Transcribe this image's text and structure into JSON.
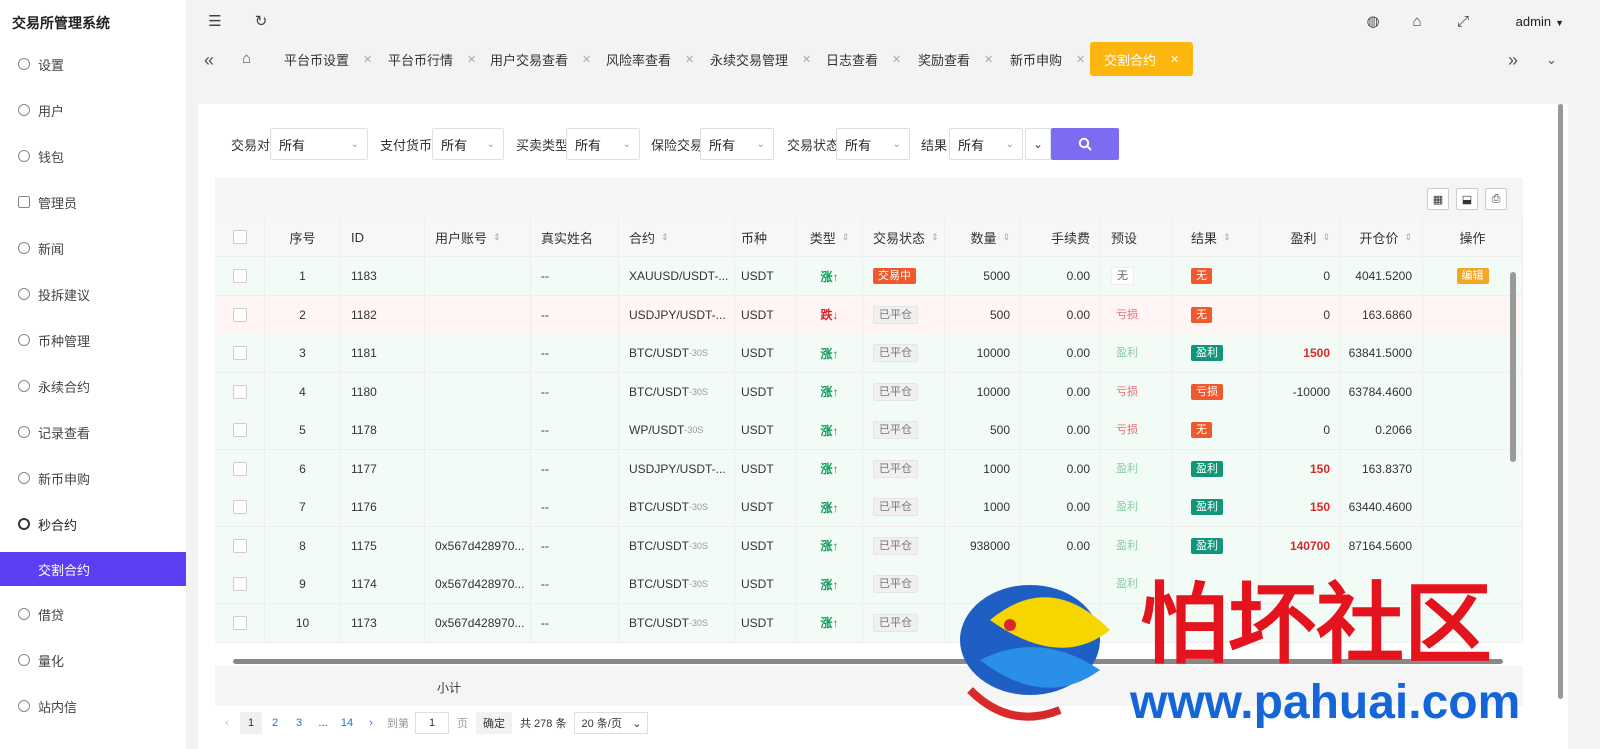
{
  "app": {
    "title": "交易所管理系统",
    "user": "admin"
  },
  "sidebar": {
    "items": [
      {
        "label": "设置"
      },
      {
        "label": "用户"
      },
      {
        "label": "钱包"
      },
      {
        "label": "管理员"
      },
      {
        "label": "新闻"
      },
      {
        "label": "投拆建议"
      },
      {
        "label": "币种管理"
      },
      {
        "label": "永续合约"
      },
      {
        "label": "记录查看"
      },
      {
        "label": "新币申购"
      },
      {
        "label": "秒合约"
      },
      {
        "label": "交割合约"
      },
      {
        "label": "借贷"
      },
      {
        "label": "量化"
      },
      {
        "label": "站内信"
      }
    ]
  },
  "tabs": [
    {
      "label": "平台币设置"
    },
    {
      "label": "平台币行情"
    },
    {
      "label": "用户交易查看"
    },
    {
      "label": "风险率查看"
    },
    {
      "label": "永续交易管理"
    },
    {
      "label": "日志查看"
    },
    {
      "label": "奖励查看"
    },
    {
      "label": "新币申购"
    },
    {
      "label": "交割合约"
    }
  ],
  "filters": [
    {
      "label": "交易对",
      "value": "所有"
    },
    {
      "label": "支付货币",
      "value": "所有"
    },
    {
      "label": "买卖类型",
      "value": "所有"
    },
    {
      "label": "保险交易",
      "value": "所有"
    },
    {
      "label": "交易状态",
      "value": "所有"
    },
    {
      "label": "结果",
      "value": "所有"
    }
  ],
  "table": {
    "headers": [
      "序号",
      "ID",
      "用户账号",
      "真实姓名",
      "合约",
      "币种",
      "类型",
      "交易状态",
      "数量",
      "手续费",
      "预设",
      "结果",
      "盈利",
      "开仓价",
      "操作"
    ],
    "rows": [
      {
        "no": "1",
        "id": "1183",
        "account": "",
        "name": "--",
        "contract": "XAUUSD/USDT-...",
        "suffix": "",
        "coin": "USDT",
        "type": "涨↑",
        "dir": "up",
        "status": "交易中",
        "status_kind": "red",
        "qty": "5000",
        "fee": "0.00",
        "preset": "无",
        "preset_kind": "plain",
        "result": "无",
        "result_kind": "red",
        "profit": "0",
        "profit_kind": "",
        "open": "4041.5200",
        "action": "编辑"
      },
      {
        "no": "2",
        "id": "1182",
        "account": "",
        "name": "--",
        "contract": "USDJPY/USDT-...",
        "suffix": "",
        "coin": "USDT",
        "type": "跌↓",
        "dir": "down",
        "status": "已平仓",
        "status_kind": "grey",
        "qty": "500",
        "fee": "0.00",
        "preset": "亏损",
        "preset_kind": "loss",
        "result": "无",
        "result_kind": "red",
        "profit": "0",
        "profit_kind": "",
        "open": "163.6860",
        "action": ""
      },
      {
        "no": "3",
        "id": "1181",
        "account": "",
        "name": "--",
        "contract": "BTC/USDT",
        "suffix": "-30S",
        "coin": "USDT",
        "type": "涨↑",
        "dir": "up",
        "status": "已平仓",
        "status_kind": "grey",
        "qty": "10000",
        "fee": "0.00",
        "preset": "盈利",
        "preset_kind": "gain",
        "result": "盈利",
        "result_kind": "green",
        "profit": "1500",
        "profit_kind": "pos",
        "open": "63841.5000",
        "action": ""
      },
      {
        "no": "4",
        "id": "1180",
        "account": "",
        "name": "--",
        "contract": "BTC/USDT",
        "suffix": "-30S",
        "coin": "USDT",
        "type": "涨↑",
        "dir": "up",
        "status": "已平仓",
        "status_kind": "grey",
        "qty": "10000",
        "fee": "0.00",
        "preset": "亏损",
        "preset_kind": "loss",
        "result": "亏损",
        "result_kind": "red",
        "profit": "-10000",
        "profit_kind": "",
        "open": "63784.4600",
        "action": ""
      },
      {
        "no": "5",
        "id": "1178",
        "account": "",
        "name": "--",
        "contract": "WP/USDT",
        "suffix": "-30S",
        "coin": "USDT",
        "type": "涨↑",
        "dir": "up",
        "status": "已平仓",
        "status_kind": "grey",
        "qty": "500",
        "fee": "0.00",
        "preset": "亏损",
        "preset_kind": "loss",
        "result": "无",
        "result_kind": "red",
        "profit": "0",
        "profit_kind": "",
        "open": "0.2066",
        "action": ""
      },
      {
        "no": "6",
        "id": "1177",
        "account": "",
        "name": "--",
        "contract": "USDJPY/USDT-...",
        "suffix": "",
        "coin": "USDT",
        "type": "涨↑",
        "dir": "up",
        "status": "已平仓",
        "status_kind": "grey",
        "qty": "1000",
        "fee": "0.00",
        "preset": "盈利",
        "preset_kind": "gain",
        "result": "盈利",
        "result_kind": "green",
        "profit": "150",
        "profit_kind": "pos",
        "open": "163.8370",
        "action": ""
      },
      {
        "no": "7",
        "id": "1176",
        "account": "",
        "name": "--",
        "contract": "BTC/USDT",
        "suffix": "-30S",
        "coin": "USDT",
        "type": "涨↑",
        "dir": "up",
        "status": "已平仓",
        "status_kind": "grey",
        "qty": "1000",
        "fee": "0.00",
        "preset": "盈利",
        "preset_kind": "gain",
        "result": "盈利",
        "result_kind": "green",
        "profit": "150",
        "profit_kind": "pos",
        "open": "63440.4600",
        "action": ""
      },
      {
        "no": "8",
        "id": "1175",
        "account": "0x567d428970...",
        "name": "--",
        "contract": "BTC/USDT",
        "suffix": "-30S",
        "coin": "USDT",
        "type": "涨↑",
        "dir": "up",
        "status": "已平仓",
        "status_kind": "grey",
        "qty": "938000",
        "fee": "0.00",
        "preset": "盈利",
        "preset_kind": "gain",
        "result": "盈利",
        "result_kind": "green",
        "profit": "140700",
        "profit_kind": "pos",
        "open": "87164.5600",
        "action": ""
      },
      {
        "no": "9",
        "id": "1174",
        "account": "0x567d428970...",
        "name": "--",
        "contract": "BTC/USDT",
        "suffix": "-30S",
        "coin": "USDT",
        "type": "涨↑",
        "dir": "up",
        "status": "已平仓",
        "status_kind": "grey",
        "qty": "",
        "fee": "",
        "preset": "盈利",
        "preset_kind": "gain",
        "result": "",
        "result_kind": "",
        "profit": "",
        "profit_kind": "",
        "open": "",
        "action": ""
      },
      {
        "no": "10",
        "id": "1173",
        "account": "0x567d428970...",
        "name": "--",
        "contract": "BTC/USDT",
        "suffix": "-30S",
        "coin": "USDT",
        "type": "涨↑",
        "dir": "up",
        "status": "已平仓",
        "status_kind": "grey",
        "qty": "",
        "fee": "",
        "preset": "",
        "preset_kind": "",
        "result": "",
        "result_kind": "",
        "profit": "",
        "profit_kind": "",
        "open": "",
        "action": ""
      }
    ],
    "subtotal_label": "小计"
  },
  "pager": {
    "pages": [
      "1",
      "2",
      "3",
      "...",
      "14"
    ],
    "goto_label": "到第",
    "goto_value": "1",
    "page_unit": "页",
    "confirm": "确定",
    "total": "共 278 条",
    "page_size": "20 条/页"
  },
  "watermark": {
    "title": "怕坏社区",
    "url": "www.pahuai.com"
  }
}
